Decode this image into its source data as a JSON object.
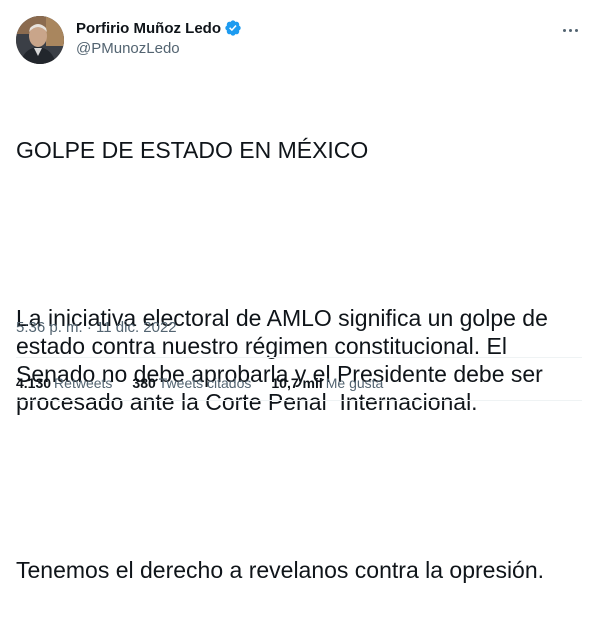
{
  "author": {
    "name": "Porfirio Muñoz Ledo",
    "handle": "@PMunozLedo",
    "verified": true,
    "avatar_icon": "profile-photo"
  },
  "menu_icon": "more-horizontal-icon",
  "tweet": {
    "title_line": "GOLPE DE ESTADO EN MÉXICO",
    "paragraph1": "La iniciativa electoral de AMLO significa un golpe de estado contra nuestro régimen constitucional. El Senado no debe aprobarla y el Presidente debe ser procesado ante la Corte Penal  Internacional.",
    "paragraph2": "Tenemos el derecho a revelanos contra la opresión.",
    "timestamp": "5:36 p. m. · 11 dic. 2022"
  },
  "stats": {
    "retweets_count": "4.130",
    "retweets_label": "Retweets",
    "quotes_count": "380",
    "quotes_label": "Tweets citados",
    "likes_count": "10,7 mil",
    "likes_label": "Me gusta"
  },
  "colors": {
    "text": "#0f1419",
    "secondary": "#536471",
    "verified_blue": "#1d9bf0",
    "divider": "#eff3f4"
  }
}
